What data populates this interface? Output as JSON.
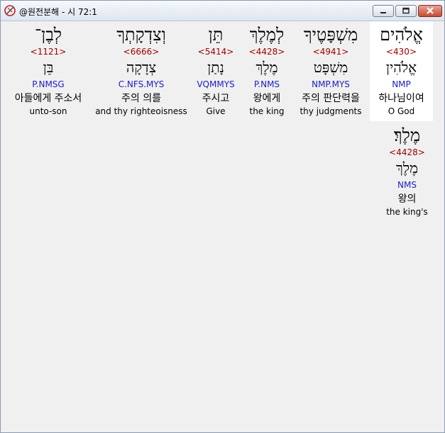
{
  "window": {
    "title": "@원전분해 - 시 72:1"
  },
  "words": [
    {
      "hebrew": "אֱלֹהִים",
      "strong": "<430>",
      "lexeme": "אֱלֹהִין",
      "morph": "NMP",
      "korean": "하나님이여",
      "english": "O God"
    },
    {
      "hebrew": "מִשְׁפָּטֶיךָ",
      "strong": "<4941>",
      "lexeme": "מִשְׁפָּט",
      "morph": "NMP.MYS",
      "korean": "주의 판단력을",
      "english": "thy judgments"
    },
    {
      "hebrew": "לְמֶלֶךְ",
      "strong": "<4428>",
      "lexeme": "מֶלֶךְ",
      "morph": "P.NMS",
      "korean": "왕에게",
      "english": "the king"
    },
    {
      "hebrew": "תֵּן",
      "strong": "<5414>",
      "lexeme": "נָתַן",
      "morph": "VQMMYS",
      "korean": "주시고",
      "english": "Give"
    },
    {
      "hebrew": "וְצִדְקָתְךָ",
      "strong": "<6666>",
      "lexeme": "צְדָקָה",
      "morph": "C.NFS.MYS",
      "korean": "주의 의를",
      "english": "and thy righteoisness"
    },
    {
      "hebrew": "לְבֶן־",
      "strong": "<1121>",
      "lexeme": "בֵּן",
      "morph": "P.NMSG",
      "korean": "아들에게 주소서",
      "english": "unto-son"
    },
    {
      "hebrew": "מֶלֶךְ׃",
      "strong": "<4428>",
      "lexeme": "מֶלֶךְ",
      "morph": "NMS",
      "korean": "왕의",
      "english": "the king's"
    }
  ]
}
